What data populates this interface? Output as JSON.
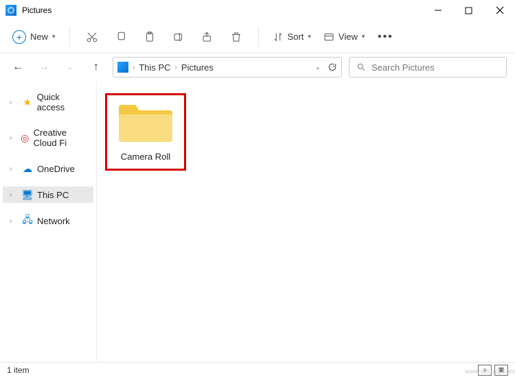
{
  "window": {
    "title": "Pictures"
  },
  "toolbar": {
    "new_label": "New",
    "sort_label": "Sort",
    "view_label": "View"
  },
  "address": {
    "crumb1": "This PC",
    "crumb2": "Pictures"
  },
  "search": {
    "placeholder": "Search Pictures"
  },
  "sidebar": {
    "quick": "Quick access",
    "ccf": "Creative Cloud Fi",
    "onedrive": "OneDrive",
    "thispc": "This PC",
    "network": "Network"
  },
  "content": {
    "folder1_label": "Camera Roll"
  },
  "status": {
    "count": "1 item"
  },
  "watermark": "www.deuaq.com"
}
